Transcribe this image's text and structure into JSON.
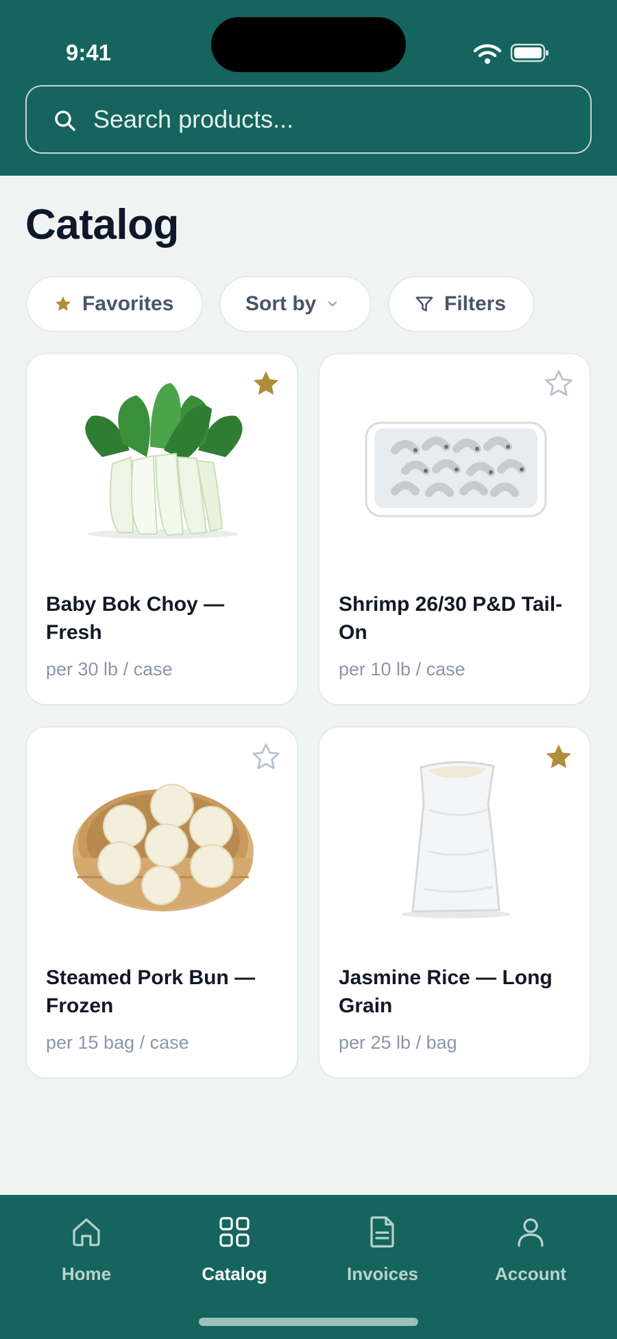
{
  "status_bar": {
    "time": "9:41"
  },
  "search": {
    "placeholder": "Search products..."
  },
  "page": {
    "title": "Catalog"
  },
  "chips": {
    "favorites": "Favorites",
    "sort": "Sort by",
    "filters": "Filters"
  },
  "products": [
    {
      "name": "Baby Bok Choy — Fresh",
      "unit": "per 30 lb / case",
      "favorite": true,
      "image": "bok-choy"
    },
    {
      "name": "Shrimp 26/30 P&D Tail-On",
      "unit": "per 10 lb / case",
      "favorite": false,
      "image": "shrimp-tray"
    },
    {
      "name": "Steamed Pork Bun — Frozen",
      "unit": "per 15 bag / case",
      "favorite": false,
      "image": "pork-buns-steamer"
    },
    {
      "name": "Jasmine Rice — Long Grain",
      "unit": "per 25 lb / bag",
      "favorite": true,
      "image": "rice-sack"
    }
  ],
  "nav": {
    "items": [
      {
        "label": "Home",
        "icon": "home-icon",
        "active": false
      },
      {
        "label": "Catalog",
        "icon": "grid-icon",
        "active": true
      },
      {
        "label": "Invoices",
        "icon": "document-icon",
        "active": false
      },
      {
        "label": "Account",
        "icon": "person-icon",
        "active": false
      }
    ]
  },
  "colors": {
    "brand": "#15645E",
    "background": "#EFF4F3",
    "favorite_star": "#B08D3A",
    "muted_text": "#8A96A8"
  }
}
